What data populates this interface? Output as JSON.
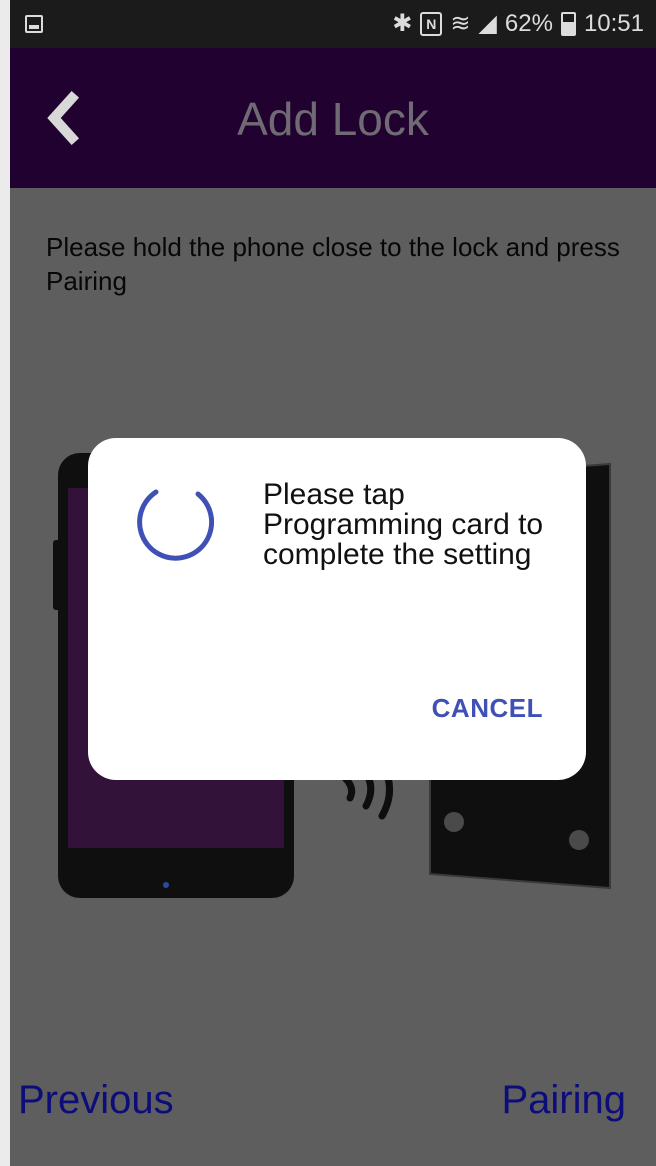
{
  "status_bar": {
    "battery_percent": "62%",
    "time": "10:51",
    "icons": [
      "gallery-icon",
      "bluetooth-icon",
      "nfc-icon",
      "wifi-icon",
      "signal-icon",
      "battery-icon"
    ],
    "bluetooth_glyph": "✱",
    "nfc_glyph": "N",
    "wifi_glyph": "≋",
    "signal_glyph": "◢"
  },
  "header": {
    "title": "Add Lock",
    "back_icon": "chevron-left-icon"
  },
  "main": {
    "instruction": "Please hold the phone close to the lock and press Pairing",
    "illustration": "phone-and-lock-illustration"
  },
  "footer": {
    "previous_label": "Previous",
    "pairing_label": "Pairing"
  },
  "dialog": {
    "message": "Please tap Programming card to complete the setting",
    "cancel_label": "CANCEL",
    "spinner_icon": "loading-spinner-icon"
  },
  "colors": {
    "app_bar": "#21012f",
    "accent": "#3f51b5",
    "footer_text": "#0d0d7a",
    "overlay_bg": "#5e5e5e"
  }
}
